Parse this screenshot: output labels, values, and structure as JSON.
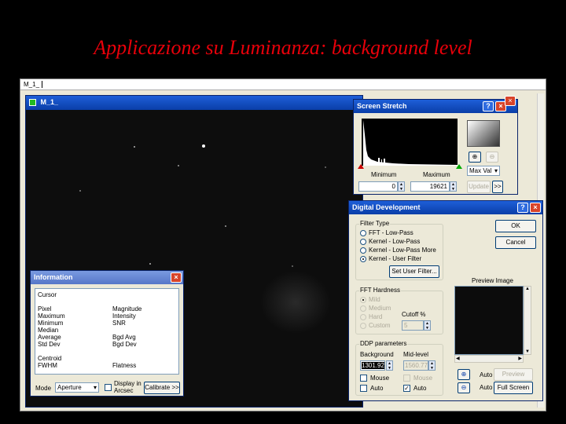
{
  "slide": {
    "title": "Applicazione  su Luminanza: background level"
  },
  "app": {
    "tab_label": "M_1_",
    "image_window_title": "M_1_"
  },
  "screen_stretch": {
    "title": "Screen Stretch",
    "minimum_label": "Minimum",
    "maximum_label": "Maximum",
    "minimum_value": "0",
    "maximum_value": "19621",
    "mode_value": "Max Val",
    "update_label": "Update",
    "more_label": ">>"
  },
  "information": {
    "title": "Information",
    "cursor_label": "Cursor",
    "left_labels": [
      "Pixel",
      "Maximum",
      "Minimum",
      "Median",
      "Average",
      "Std Dev",
      "",
      "Centroid",
      "FWHM"
    ],
    "right_labels": [
      "Magnitude",
      "Intensity",
      "SNR",
      "",
      "Bgd Avg",
      "Bgd Dev",
      "",
      "",
      "Flatness"
    ],
    "mode_label": "Mode",
    "mode_value": "Aperture",
    "display_arcsec_label_1": "Display in",
    "display_arcsec_label_2": "Arcsec",
    "calibrate_label": "Calibrate >>"
  },
  "digital_development": {
    "title": "Digital Development",
    "filter_type_label": "Filter Type",
    "filter_options": [
      "FFT - Low-Pass",
      "Kernel - Low-Pass",
      "Kernel - Low-Pass More",
      "Kernel - User Filter"
    ],
    "set_user_filter_label": "Set User Filter...",
    "ok_label": "OK",
    "cancel_label": "Cancel",
    "fft_hardness_label": "FFT Hardness",
    "hardness_options": [
      "Mild",
      "Medium",
      "Hard",
      "Custom"
    ],
    "cutoff_label": "Cutoff %",
    "cutoff_value": "5",
    "ddp_parameters_label": "DDP parameters",
    "background_label": "Background",
    "midlevel_label": "Mid-level",
    "background_value": "1301.92",
    "midlevel_value": "1560.77",
    "mouse_label": "Mouse",
    "auto_label": "Auto",
    "preview_image_label": "Preview Image",
    "zoom_auto_label": "Auto",
    "preview_button_label": "Preview",
    "full_screen_label": "Full Screen"
  },
  "colors": {
    "title_red": "#e8000a",
    "xp_blue": "#0a3ea8",
    "dialog_bg": "#ece9d8"
  }
}
